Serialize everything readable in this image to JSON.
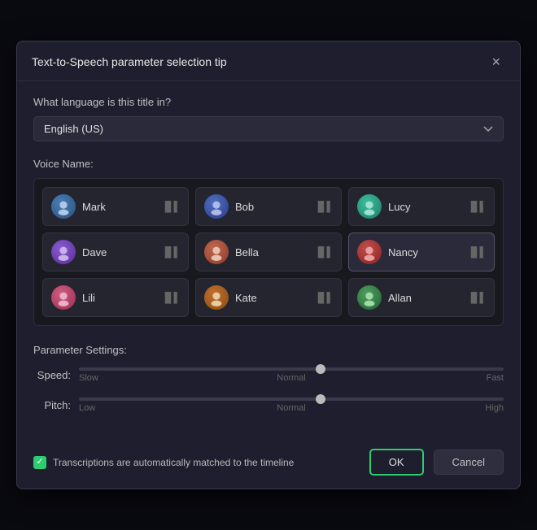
{
  "dialog": {
    "title": "Text-to-Speech parameter selection tip",
    "close_label": "×"
  },
  "language_section": {
    "question": "What language is this title in?",
    "selected": "English (US)"
  },
  "voice_section": {
    "label": "Voice Name:",
    "voices": [
      {
        "id": "mark",
        "name": "Mark",
        "avatar_class": "av-blue"
      },
      {
        "id": "bob",
        "name": "Bob",
        "avatar_class": "av-indigo"
      },
      {
        "id": "lucy",
        "name": "Lucy",
        "avatar_class": "av-teal"
      },
      {
        "id": "dave",
        "name": "Dave",
        "avatar_class": "av-purple"
      },
      {
        "id": "bella",
        "name": "Bella",
        "avatar_class": "av-coral"
      },
      {
        "id": "nancy",
        "name": "Nancy",
        "avatar_class": "av-red",
        "selected": true
      },
      {
        "id": "lili",
        "name": "Lili",
        "avatar_class": "av-pink"
      },
      {
        "id": "kate",
        "name": "Kate",
        "avatar_class": "av-orange"
      },
      {
        "id": "allan",
        "name": "Allan",
        "avatar_class": "av-green"
      }
    ]
  },
  "params_section": {
    "label": "Parameter Settings:",
    "speed": {
      "label": "Speed:",
      "value": 57,
      "labels": {
        "min": "Slow",
        "mid": "Normal",
        "max": "Fast"
      }
    },
    "pitch": {
      "label": "Pitch:",
      "value": 57,
      "labels": {
        "min": "Low",
        "mid": "Normal",
        "max": "High"
      }
    }
  },
  "footer": {
    "checkbox_label": "Transcriptions are automatically matched to the timeline",
    "checkbox_checked": true,
    "ok_label": "OK",
    "cancel_label": "Cancel"
  }
}
